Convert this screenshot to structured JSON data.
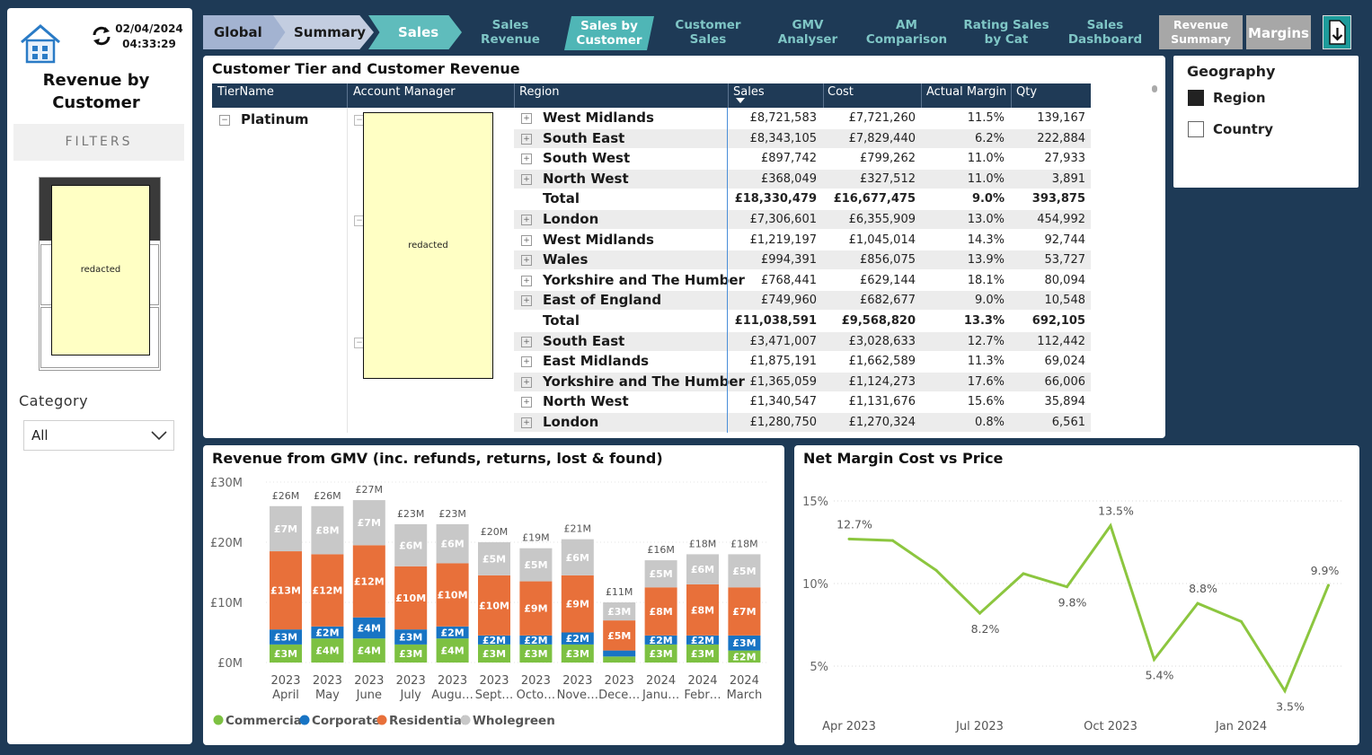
{
  "sidebar": {
    "date": "02/04/2024",
    "time": "04:33:29",
    "title_line1": "Revenue by",
    "title_line2": "Customer",
    "filters_label": "FILTERS",
    "redacted_label": "redacted",
    "category_label": "Category",
    "category_value": "All"
  },
  "nav": {
    "crumbs": [
      "Global",
      "Summary",
      "Sales"
    ],
    "links": [
      {
        "l1": "Sales",
        "l2": "Revenue"
      },
      {
        "l1": "Customer",
        "l2": "Sales"
      },
      {
        "l1": "GMV",
        "l2": "Analyser"
      },
      {
        "l1": "AM",
        "l2": "Comparison"
      },
      {
        "l1": "Rating Sales",
        "l2": "by Cat"
      },
      {
        "l1": "Sales",
        "l2": "Dashboard"
      }
    ],
    "active_l1": "Sales by",
    "active_l2": "Customer",
    "revenue_summary_l1": "Revenue",
    "revenue_summary_l2": "Summary",
    "margins": "Margins"
  },
  "table": {
    "title": "Customer Tier and Customer Revenue",
    "headers": [
      "TierName",
      "Account Manager",
      "Region",
      "Sales",
      "Cost",
      "Actual Margin",
      "Qty"
    ],
    "tier": "Platinum",
    "redacted_label": "redacted",
    "rows": [
      {
        "region": "West Midlands",
        "sales": "£8,721,583",
        "cost": "£7,721,260",
        "margin": "11.5%",
        "qty": "139,167",
        "total": false
      },
      {
        "region": "South East",
        "sales": "£8,343,105",
        "cost": "£7,829,440",
        "margin": "6.2%",
        "qty": "222,884",
        "total": false
      },
      {
        "region": "South West",
        "sales": "£897,742",
        "cost": "£799,262",
        "margin": "11.0%",
        "qty": "27,933",
        "total": false
      },
      {
        "region": "North West",
        "sales": "£368,049",
        "cost": "£327,512",
        "margin": "11.0%",
        "qty": "3,891",
        "total": false
      },
      {
        "region": "Total",
        "sales": "£18,330,479",
        "cost": "£16,677,475",
        "margin": "9.0%",
        "qty": "393,875",
        "total": true
      },
      {
        "region": "London",
        "sales": "£7,306,601",
        "cost": "£6,355,909",
        "margin": "13.0%",
        "qty": "454,992",
        "total": false
      },
      {
        "region": "West Midlands",
        "sales": "£1,219,197",
        "cost": "£1,045,014",
        "margin": "14.3%",
        "qty": "92,744",
        "total": false
      },
      {
        "region": "Wales",
        "sales": "£994,391",
        "cost": "£856,075",
        "margin": "13.9%",
        "qty": "53,727",
        "total": false
      },
      {
        "region": "Yorkshire and The Humber",
        "sales": "£768,441",
        "cost": "£629,144",
        "margin": "18.1%",
        "qty": "80,094",
        "total": false
      },
      {
        "region": "East of England",
        "sales": "£749,960",
        "cost": "£682,677",
        "margin": "9.0%",
        "qty": "10,548",
        "total": false
      },
      {
        "region": "Total",
        "sales": "£11,038,591",
        "cost": "£9,568,820",
        "margin": "13.3%",
        "qty": "692,105",
        "total": true
      },
      {
        "region": "South East",
        "sales": "£3,471,007",
        "cost": "£3,028,633",
        "margin": "12.7%",
        "qty": "112,442",
        "total": false
      },
      {
        "region": "East Midlands",
        "sales": "£1,875,191",
        "cost": "£1,662,589",
        "margin": "11.3%",
        "qty": "69,024",
        "total": false
      },
      {
        "region": "Yorkshire and The Humber",
        "sales": "£1,365,059",
        "cost": "£1,124,273",
        "margin": "17.6%",
        "qty": "66,006",
        "total": false
      },
      {
        "region": "North West",
        "sales": "£1,340,547",
        "cost": "£1,131,676",
        "margin": "15.6%",
        "qty": "35,894",
        "total": false
      },
      {
        "region": "London",
        "sales": "£1,280,750",
        "cost": "£1,270,324",
        "margin": "0.8%",
        "qty": "6,561",
        "total": false
      }
    ]
  },
  "geography": {
    "title": "Geography",
    "options": [
      {
        "label": "Region",
        "checked": true
      },
      {
        "label": "Country",
        "checked": false
      }
    ]
  },
  "colors": {
    "commercial": "#7dc142",
    "corporate": "#1874c4",
    "residential": "#e8703a",
    "wholegreen": "#c8c8c8",
    "line": "#8cc63f",
    "header": "#1f3a56",
    "nav_active": "#4fb6b6"
  },
  "chart_data": [
    {
      "type": "bar",
      "stacked": true,
      "title": "Revenue from GMV (inc. refunds, returns, lost & found)",
      "ylim": [
        0,
        30
      ],
      "yticks": [
        "£0M",
        "£10M",
        "£20M",
        "£30M"
      ],
      "grid": true,
      "legend": "bottom",
      "categories": [
        {
          "year": "2023",
          "month": "April"
        },
        {
          "year": "2023",
          "month": "May"
        },
        {
          "year": "2023",
          "month": "June"
        },
        {
          "year": "2023",
          "month": "July"
        },
        {
          "year": "2023",
          "month": "Augu…"
        },
        {
          "year": "2023",
          "month": "Sept…"
        },
        {
          "year": "2023",
          "month": "Octo…"
        },
        {
          "year": "2023",
          "month": "Nove…"
        },
        {
          "year": "2023",
          "month": "Dece…"
        },
        {
          "year": "2024",
          "month": "Janu…"
        },
        {
          "year": "2024",
          "month": "Febr…"
        },
        {
          "year": "2024",
          "month": "March"
        }
      ],
      "totals": [
        "£26M",
        "£26M",
        "£27M",
        "£23M",
        "£23M",
        "£20M",
        "£19M",
        "£21M",
        "£11M",
        "£16M",
        "£18M",
        "£18M"
      ],
      "series": [
        {
          "name": "Commercial",
          "values": [
            3,
            4,
            4,
            3,
            4,
            3,
            3,
            3,
            1,
            3,
            3,
            2
          ],
          "labels": [
            "£3M",
            "£4M",
            "£4M",
            "£3M",
            "£4M",
            "£3M",
            "£3M",
            "£3M",
            "",
            "£3M",
            "£3M",
            "£2M"
          ]
        },
        {
          "name": "Corporate",
          "values": [
            2.5,
            2,
            3.5,
            2.5,
            2,
            1.5,
            1.5,
            2,
            1,
            1.5,
            1.5,
            2.5
          ],
          "labels": [
            "£3M",
            "£2M",
            "£4M",
            "£3M",
            "£2M",
            "£2M",
            "£2M",
            "£2M",
            "",
            "£2M",
            "£2M",
            "£3M"
          ]
        },
        {
          "name": "Residential",
          "values": [
            13,
            12,
            12,
            10.5,
            10.5,
            10,
            9,
            9.5,
            5,
            8,
            8.5,
            8
          ],
          "labels": [
            "£13M",
            "£12M",
            "£12M",
            "£10M",
            "£10M",
            "£10M",
            "£9M",
            "£9M",
            "£5M",
            "£8M",
            "£8M",
            "£7M"
          ]
        },
        {
          "name": "Wholegreen",
          "values": [
            7.5,
            8,
            7.5,
            7,
            6.5,
            5.5,
            5.5,
            6,
            3,
            4.5,
            5,
            5.5
          ],
          "labels": [
            "£7M",
            "£8M",
            "£7M",
            "£6M",
            "£6M",
            "£5M",
            "£5M",
            "£6M",
            "£3M",
            "£5M",
            "£6M",
            "£5M"
          ]
        }
      ]
    },
    {
      "type": "line",
      "title": "Net Margin Cost vs Price",
      "ylim": [
        3,
        16
      ],
      "yticks": [
        "5%",
        "10%",
        "15%"
      ],
      "xticks": [
        "Apr 2023",
        "Jul 2023",
        "Oct 2023",
        "Jan 2024"
      ],
      "grid": true,
      "x": [
        "Apr 2023",
        "May 2023",
        "Jun 2023",
        "Jul 2023",
        "Aug 2023",
        "Sep 2023",
        "Oct 2023",
        "Nov 2023",
        "Dec 2023",
        "Jan 2024",
        "Feb 2024",
        "Mar 2024"
      ],
      "values": [
        12.7,
        12.6,
        10.8,
        8.2,
        10.6,
        9.8,
        13.5,
        5.4,
        8.8,
        7.7,
        3.5,
        9.9
      ],
      "labels": [
        "12.7%",
        "",
        "",
        "8.2%",
        "",
        "9.8%",
        "13.5%",
        "5.4%",
        "8.8%",
        "",
        "3.5%",
        "9.9%"
      ]
    }
  ]
}
